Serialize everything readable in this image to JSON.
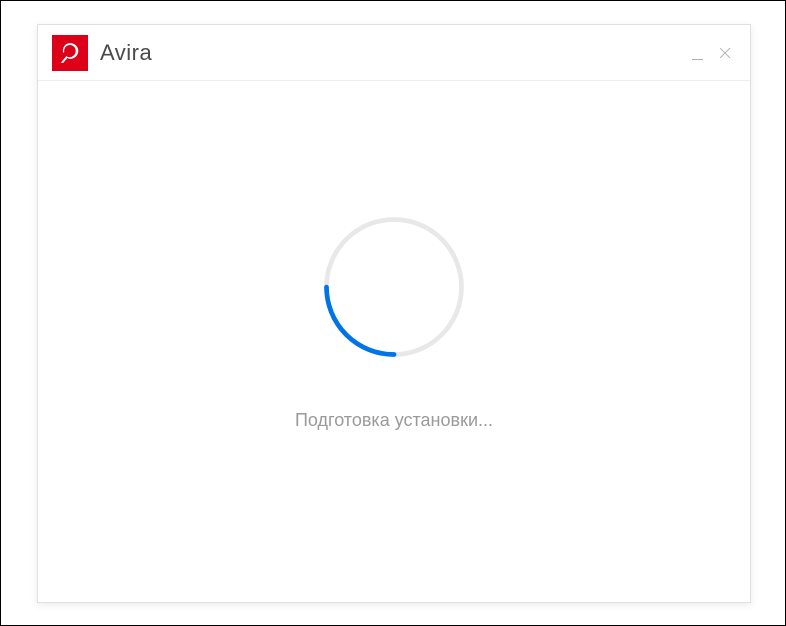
{
  "titlebar": {
    "app_name": "Avira",
    "logo_bg": "#dc0018"
  },
  "content": {
    "status_text": "Подготовка установки...",
    "spinner_color": "#0073e6",
    "spinner_track_color": "#e8e8e8"
  }
}
